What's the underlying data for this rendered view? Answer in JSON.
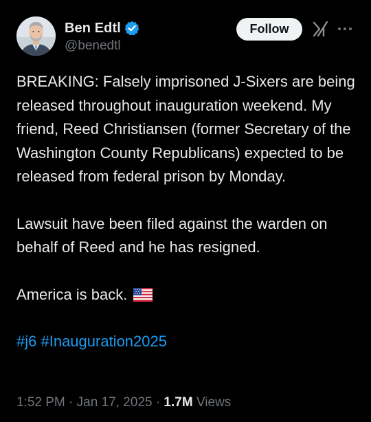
{
  "author": {
    "display_name": "Ben Edtl",
    "handle": "@benedtl",
    "verified": true
  },
  "actions": {
    "follow_label": "Follow",
    "grok_icon": "grok-icon",
    "more_icon": "more-icon"
  },
  "tweet": {
    "paragraphs": [
      "BREAKING: Falsely imprisoned J-Sixers are being released throughout inauguration weekend. My friend, Reed Christiansen (former Secretary of the Washington County Republicans) expected to be released from federal prison by Monday.",
      "Lawsuit have been filed against the warden on behalf of Reed and he has resigned.",
      "America is back."
    ],
    "emoji": "us-flag",
    "hashtags": [
      "#j6",
      "#Inauguration2025"
    ]
  },
  "meta": {
    "time": "1:52 PM",
    "separator": "·",
    "date": "Jan 17, 2025",
    "views_count": "1.7M",
    "views_label": "Views"
  },
  "colors": {
    "background": "#000000",
    "text": "#e7e9ea",
    "secondary": "#71767b",
    "accent": "#1d9bf0",
    "follow_bg": "#eff3f4"
  }
}
